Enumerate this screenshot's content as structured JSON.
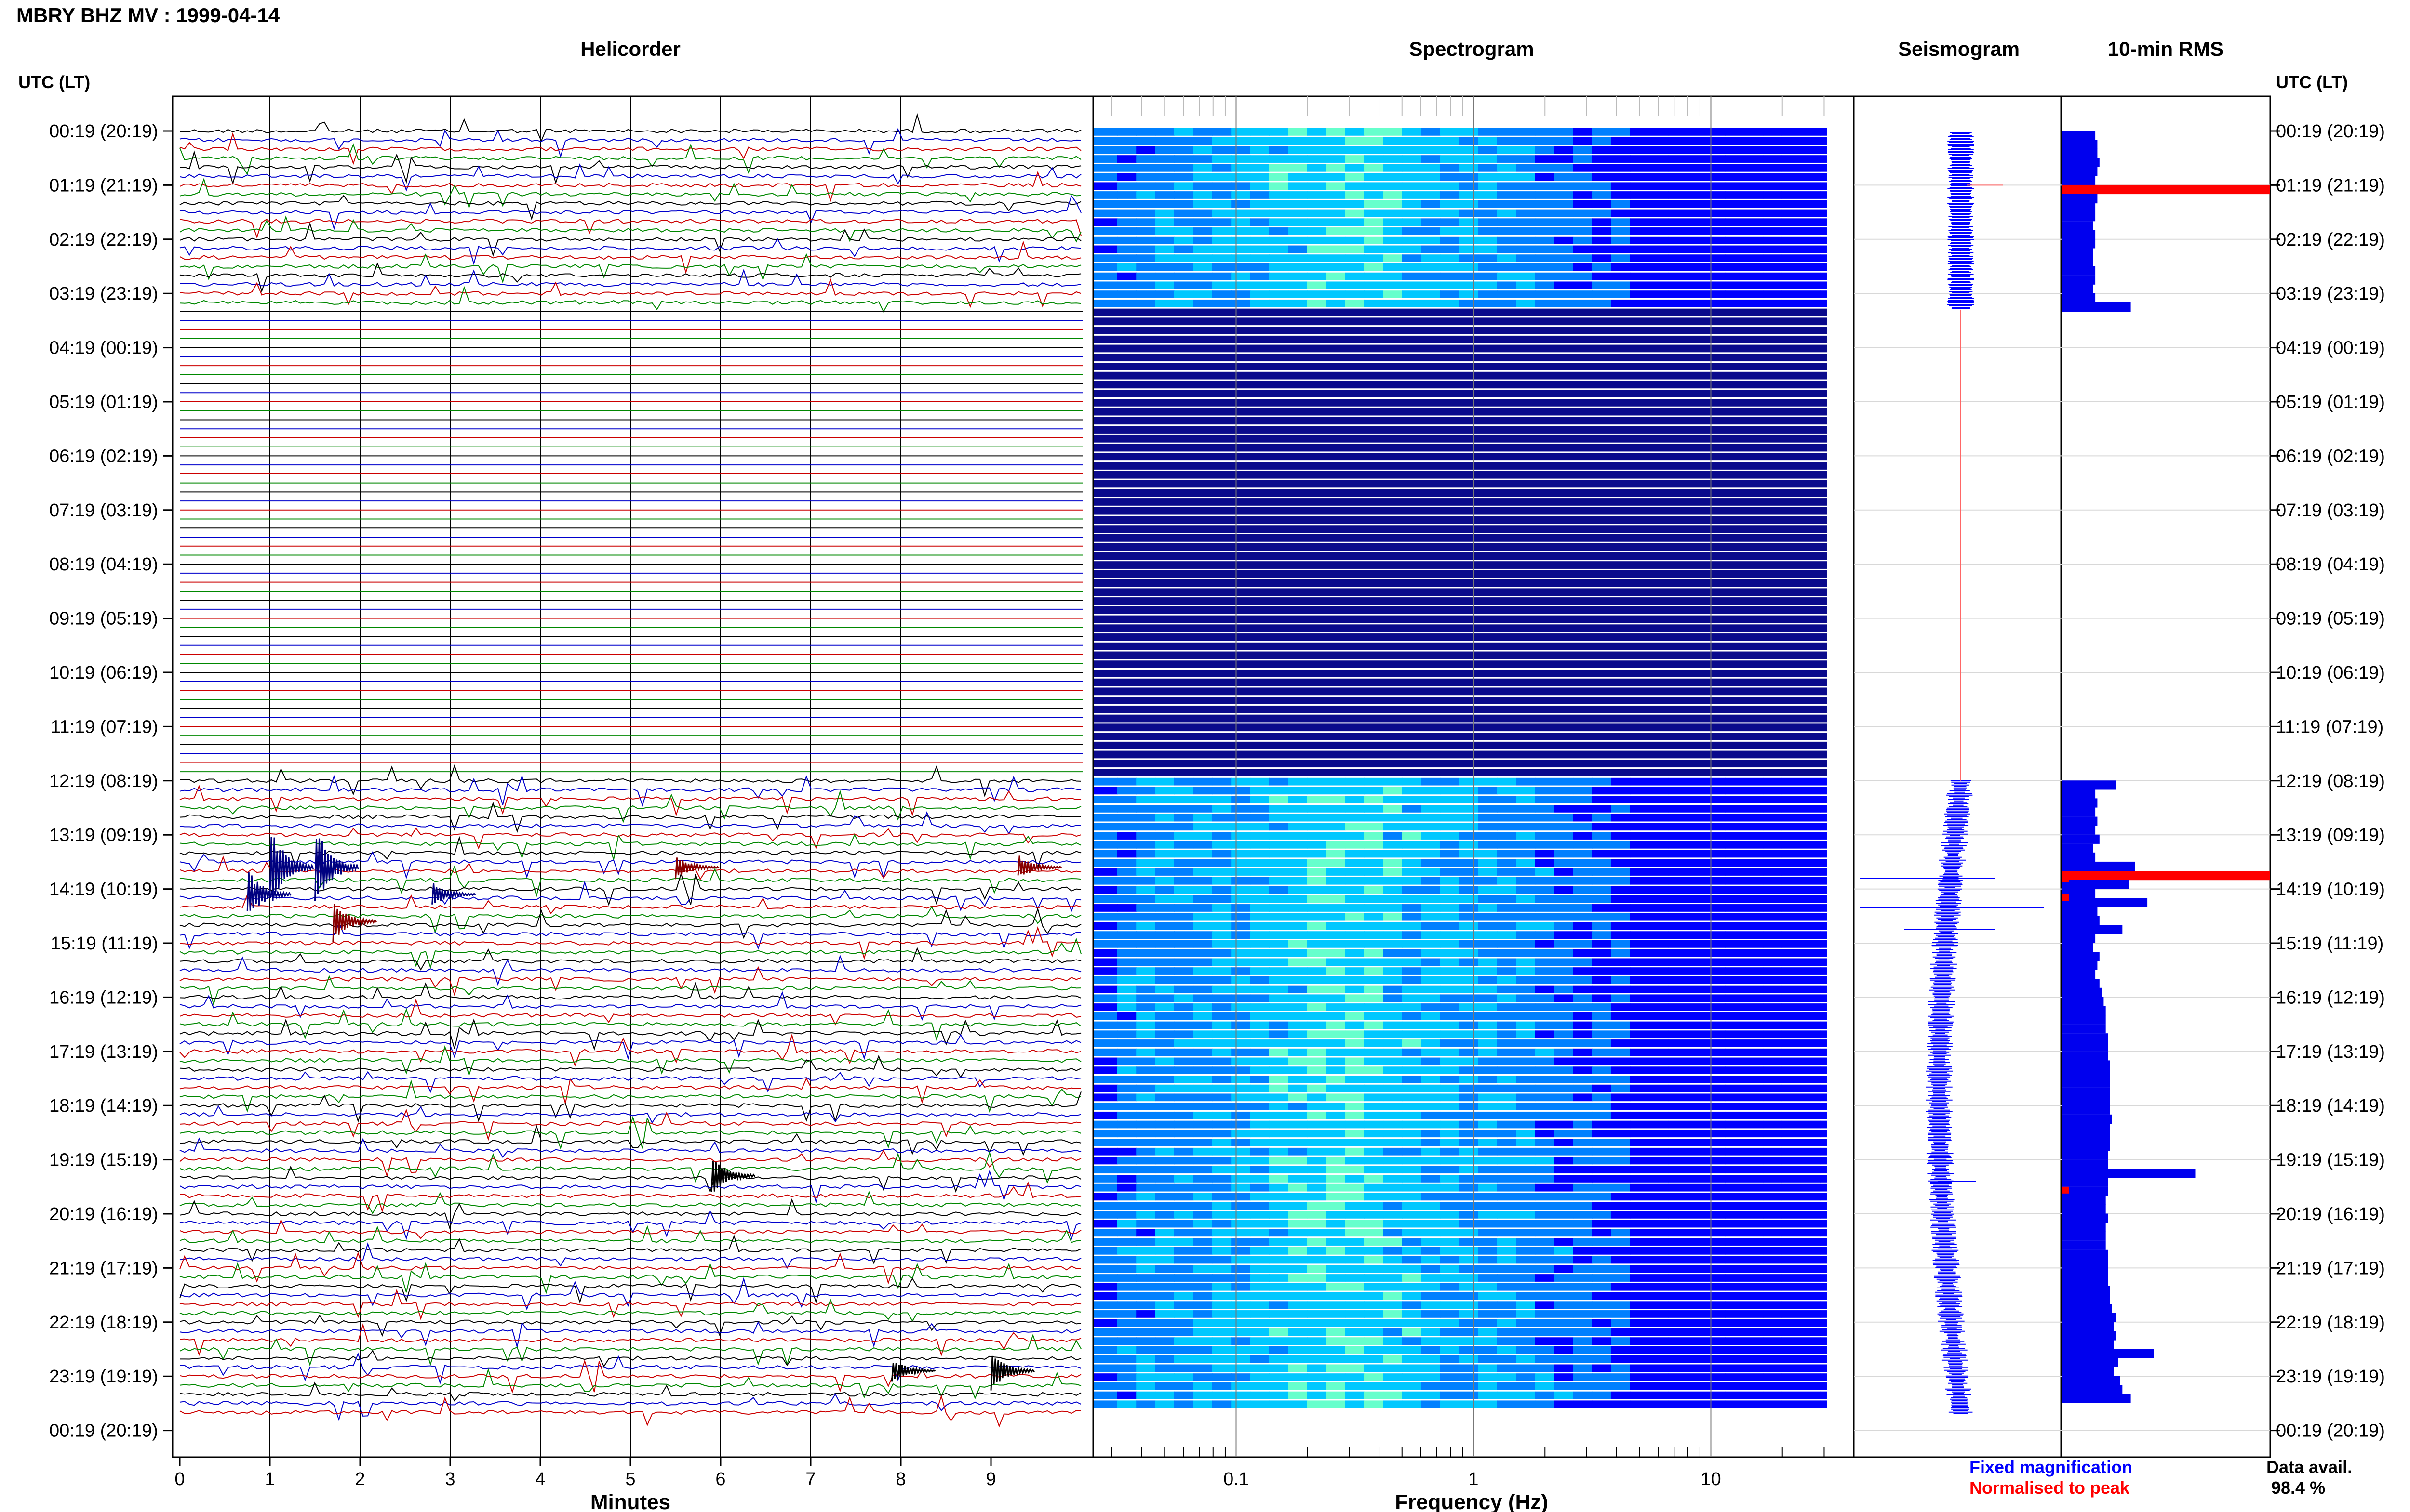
{
  "page": {
    "title": "MBRY BHZ MV : 1999-04-14",
    "utc_label_left": "UTC (LT)",
    "utc_label_right": "UTC (LT)"
  },
  "panels": {
    "helicorder": "Helicorder",
    "spectrogram": "Spectrogram",
    "seismogram": "Seismogram",
    "rms": "10-min RMS"
  },
  "legend": {
    "fixed": "Fixed magnification",
    "normalised": "Normalised to peak",
    "fixed_color": "#0000ff",
    "normalised_color": "#ff0000",
    "avail_label": "Data avail.",
    "avail_value": "98.4 %"
  },
  "chart_data": {
    "type": "heatmap",
    "time_labels": [
      "00:19 (20:19)",
      "01:19 (21:19)",
      "02:19 (22:19)",
      "03:19 (23:19)",
      "04:19 (00:19)",
      "05:19 (01:19)",
      "06:19 (02:19)",
      "07:19 (03:19)",
      "08:19 (04:19)",
      "09:19 (05:19)",
      "10:19 (06:19)",
      "11:19 (07:19)",
      "12:19 (08:19)",
      "13:19 (09:19)",
      "14:19 (10:19)",
      "15:19 (11:19)",
      "16:19 (12:19)",
      "17:19 (13:19)",
      "18:19 (14:19)",
      "19:19 (15:19)",
      "20:19 (16:19)",
      "21:19 (17:19)",
      "22:19 (18:19)",
      "23:19 (19:19)",
      "00:19 (20:19)"
    ],
    "helicorder": {
      "xlabel": "Minutes",
      "xticks": [
        "0",
        "1",
        "2",
        "3",
        "4",
        "5",
        "6",
        "7",
        "8",
        "9"
      ],
      "xlim": [
        0,
        10
      ],
      "trace_colors": [
        "#000000",
        "#0000cc",
        "#cc0000",
        "#008800"
      ],
      "data_gap_hours": [
        3.25,
        12.0
      ],
      "events": [
        {
          "hour": 13.6,
          "minute": 1.0,
          "amp": 1.0,
          "color": "#000080"
        },
        {
          "hour": 13.6,
          "minute": 1.5,
          "amp": 1.0,
          "color": "#000080"
        },
        {
          "hour": 14.1,
          "minute": 0.75,
          "amp": 0.6,
          "color": "#000080"
        },
        {
          "hour": 14.1,
          "minute": 2.8,
          "amp": 0.3,
          "color": "#000080"
        },
        {
          "hour": 13.6,
          "minute": 5.5,
          "amp": 0.3,
          "color": "#880000"
        },
        {
          "hour": 13.6,
          "minute": 9.3,
          "amp": 0.3,
          "color": "#880000"
        },
        {
          "hour": 14.6,
          "minute": 1.7,
          "amp": 0.5,
          "color": "#880000"
        },
        {
          "hour": 19.3,
          "minute": 5.9,
          "amp": 0.5,
          "color": "#000000"
        },
        {
          "hour": 22.9,
          "minute": 9.0,
          "amp": 0.5,
          "color": "#000000"
        },
        {
          "hour": 22.9,
          "minute": 7.9,
          "amp": 0.3,
          "color": "#000000"
        }
      ]
    },
    "spectrogram": {
      "xlabel": "Frequency (Hz)",
      "xscale": "log",
      "xlim": [
        0.025,
        40
      ],
      "xticks": [
        "0.1",
        "1",
        "10"
      ],
      "colormap": [
        "#0a0a8c",
        "#0000ff",
        "#0080ff",
        "#00c8ff",
        "#66ffcc",
        "#ccff66"
      ]
    },
    "rms": {
      "hours": [
        0.0,
        0.17,
        0.33,
        0.5,
        0.67,
        0.83,
        1.0,
        1.17,
        1.33,
        1.5,
        1.67,
        1.83,
        2.0,
        2.17,
        2.33,
        2.5,
        2.67,
        2.83,
        3.0,
        3.17,
        12.0,
        12.17,
        12.33,
        12.5,
        12.67,
        12.83,
        13.0,
        13.17,
        13.33,
        13.5,
        13.67,
        13.83,
        14.0,
        14.17,
        14.33,
        14.5,
        14.67,
        14.83,
        15.0,
        15.17,
        15.33,
        15.5,
        15.67,
        15.83,
        16.0,
        16.17,
        16.33,
        16.5,
        16.67,
        16.83,
        17.0,
        17.17,
        17.33,
        17.5,
        17.67,
        17.83,
        18.0,
        18.17,
        18.33,
        18.5,
        18.67,
        18.83,
        19.0,
        19.17,
        19.33,
        19.5,
        19.67,
        19.83,
        20.0,
        20.17,
        20.33,
        20.5,
        20.67,
        20.83,
        21.0,
        21.17,
        21.33,
        21.5,
        21.67,
        21.83,
        22.0,
        22.17,
        22.33,
        22.5,
        22.67,
        22.83,
        23.0,
        23.17,
        23.33,
        23.5,
        23.67,
        23.83
      ],
      "values": [
        0.16,
        0.17,
        0.17,
        0.18,
        0.17,
        0.16,
        1.0,
        0.17,
        0.16,
        0.16,
        0.15,
        0.16,
        0.16,
        0.15,
        0.15,
        0.16,
        0.16,
        0.15,
        0.16,
        0.33,
        0.26,
        0.16,
        0.17,
        0.16,
        0.17,
        0.16,
        0.18,
        0.15,
        0.16,
        0.35,
        1.0,
        0.32,
        0.16,
        0.41,
        0.17,
        0.18,
        0.29,
        0.16,
        0.15,
        0.18,
        0.17,
        0.16,
        0.18,
        0.19,
        0.2,
        0.21,
        0.21,
        0.21,
        0.22,
        0.22,
        0.22,
        0.23,
        0.23,
        0.23,
        0.23,
        0.23,
        0.23,
        0.24,
        0.23,
        0.23,
        0.23,
        0.22,
        0.22,
        0.64,
        0.22,
        0.22,
        0.21,
        0.21,
        0.22,
        0.21,
        0.21,
        0.21,
        0.22,
        0.22,
        0.22,
        0.22,
        0.23,
        0.23,
        0.24,
        0.26,
        0.25,
        0.26,
        0.25,
        0.44,
        0.27,
        0.25,
        0.28,
        0.29,
        0.33
      ]
    }
  }
}
